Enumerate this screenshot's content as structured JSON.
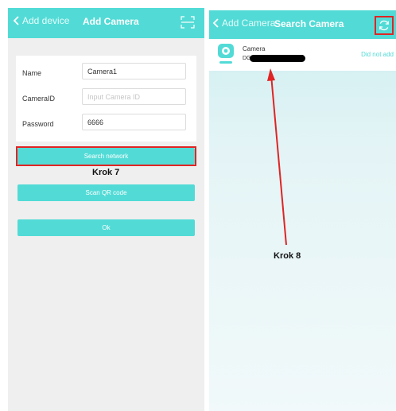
{
  "left": {
    "header": {
      "back_label": "Add device",
      "title": "Add Camera"
    },
    "form": {
      "name_label": "Name",
      "name_value": "Camera1",
      "camera_id_label": "CameraID",
      "camera_id_placeholder": "Input Camera ID",
      "password_label": "Password",
      "password_value": "6666"
    },
    "buttons": {
      "search_network": "Search network",
      "scan_qr": "Scan QR code",
      "ok": "Ok"
    },
    "annotation": "Krok 7"
  },
  "right": {
    "header": {
      "back_label": "Add Camera",
      "title": "Search Camera"
    },
    "camera": {
      "name": "Camera",
      "id_prefix": "DG",
      "status": "Did not add"
    },
    "annotation": "Krok 8"
  },
  "colors": {
    "accent": "#52dbd6",
    "highlight": "#e02424",
    "background": "#efefef"
  },
  "icons": {
    "back": "chevron-left-icon",
    "scan": "scan-frame-icon",
    "refresh": "refresh-icon",
    "camera": "camera-icon"
  }
}
